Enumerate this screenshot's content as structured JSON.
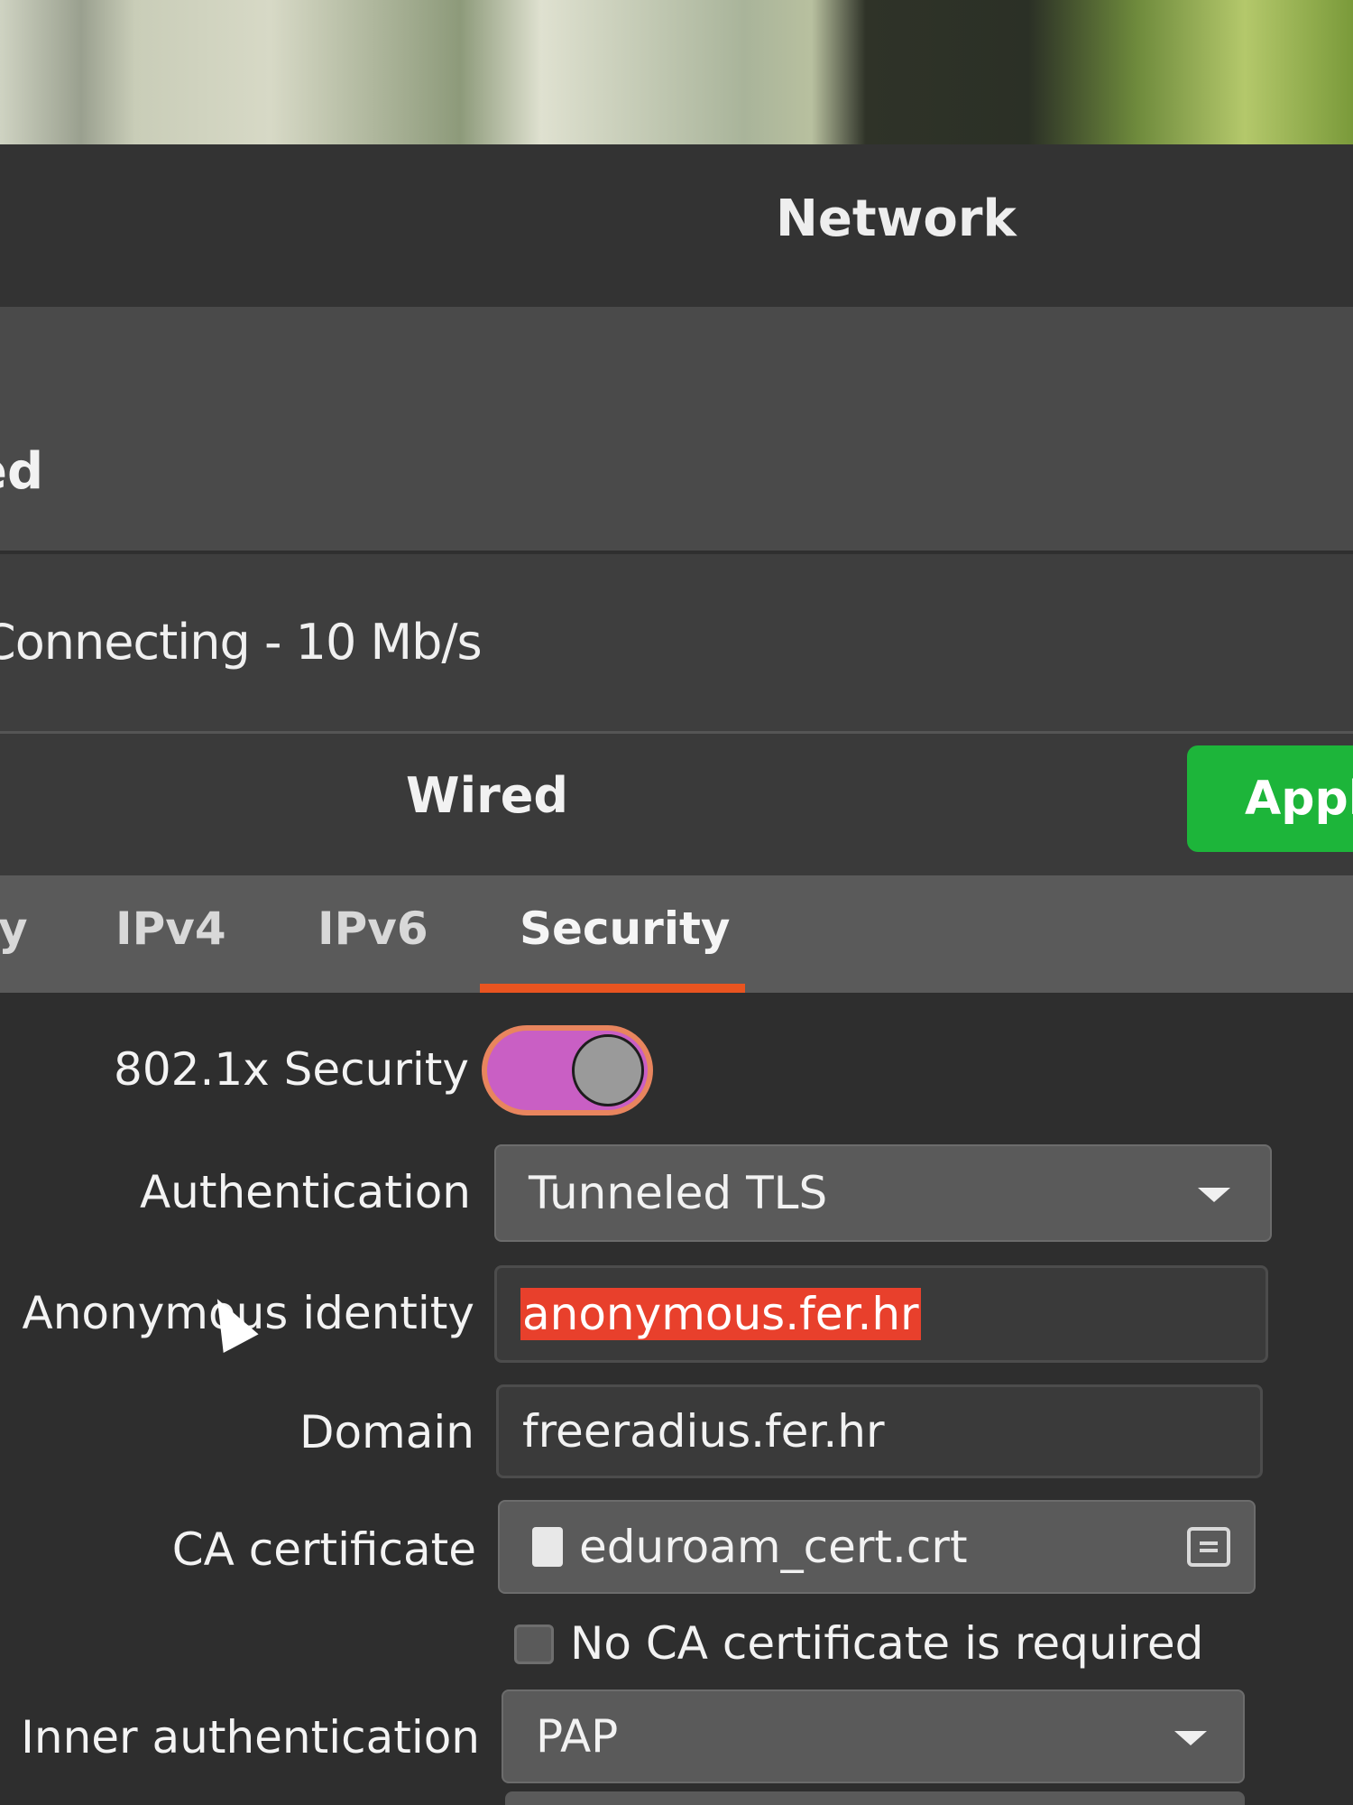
{
  "window": {
    "title": "Network"
  },
  "main": {
    "section_label": "ed",
    "status": "Connecting - 10 Mb/s"
  },
  "dialog": {
    "title": "Wired",
    "apply_label": "Apply",
    "tabs": [
      {
        "label": "y"
      },
      {
        "label": "IPv4"
      },
      {
        "label": "IPv6"
      },
      {
        "label": "Security",
        "active": true
      }
    ],
    "security": {
      "toggle_label": "802.1x Security",
      "toggle_on": true,
      "authentication_label": "Authentication",
      "authentication_value": "Tunneled TLS",
      "anon_identity_label": "Anonymous identity",
      "anon_identity_value": "anonymous.fer.hr",
      "domain_label": "Domain",
      "domain_value": "freeradius.fer.hr",
      "ca_cert_label": "CA certificate",
      "ca_cert_value": "eduroam_cert.crt",
      "no_ca_label": "No CA certificate is required",
      "no_ca_checked": false,
      "inner_auth_label": "Inner authentication",
      "inner_auth_value": "PAP"
    }
  },
  "colors": {
    "accent": "#e95420",
    "apply": "#1db53a",
    "toggle_on": "#c95fc4",
    "selection": "#e8402c"
  },
  "icons": [
    "chevron-down-icon",
    "file-icon",
    "browse-file-icon",
    "mouse-cursor-icon"
  ]
}
